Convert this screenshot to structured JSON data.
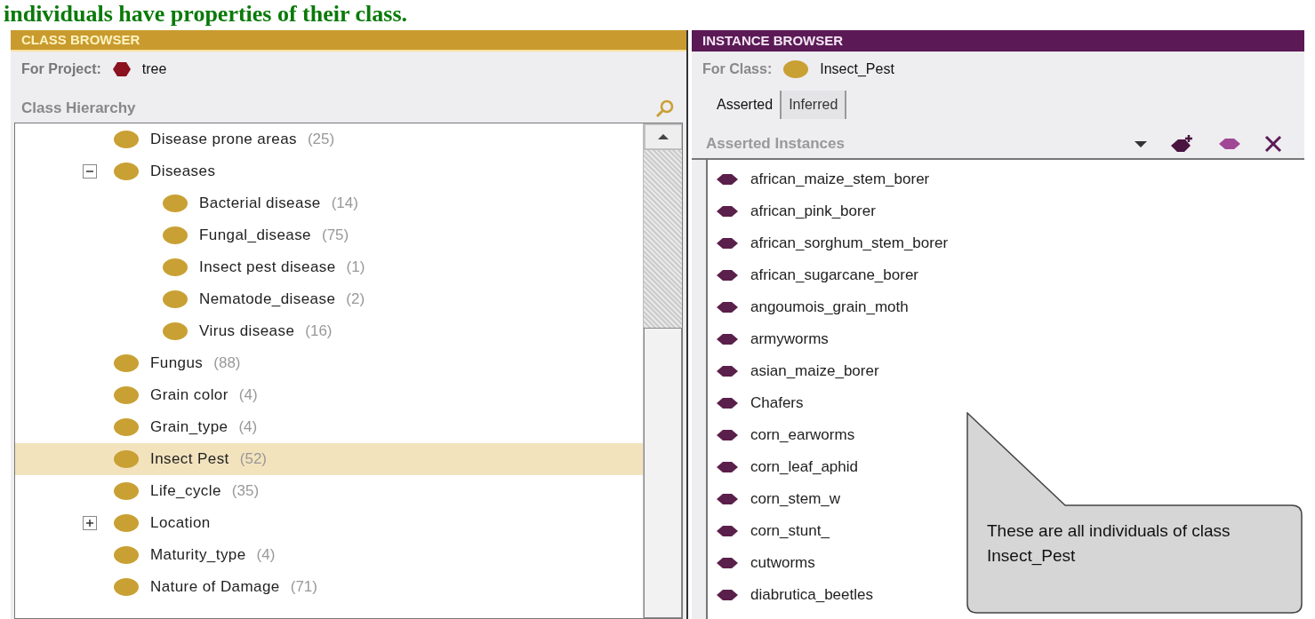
{
  "heading": "individuals have properties of their class.",
  "class_browser": {
    "title": "CLASS BROWSER",
    "project_label": "For Project:",
    "project_name": "tree",
    "hierarchy_label": "Class Hierarchy",
    "tree": [
      {
        "label": "Disease prone areas",
        "count": "(25)",
        "has_children": false,
        "expanded": false,
        "selected": false
      },
      {
        "label": "Diseases",
        "has_children": true,
        "expanded": true,
        "selected": false,
        "children": [
          {
            "label": "Bacterial disease",
            "count": "(14)",
            "has_children": false,
            "expanded": false,
            "selected": false
          },
          {
            "label": "Fungal_disease",
            "count": "(75)",
            "has_children": false,
            "expanded": false,
            "selected": false
          },
          {
            "label": "Insect pest disease",
            "count": "(1)",
            "has_children": false,
            "expanded": false,
            "selected": false
          },
          {
            "label": "Nematode_disease",
            "count": "(2)",
            "has_children": false,
            "expanded": false,
            "selected": false
          },
          {
            "label": "Virus disease",
            "count": "(16)",
            "has_children": false,
            "expanded": false,
            "selected": false
          }
        ]
      },
      {
        "label": "Fungus",
        "count": "(88)",
        "has_children": false,
        "expanded": false,
        "selected": false
      },
      {
        "label": "Grain color",
        "count": "(4)",
        "has_children": false,
        "expanded": false,
        "selected": false
      },
      {
        "label": "Grain_type",
        "count": "(4)",
        "has_children": false,
        "expanded": false,
        "selected": false
      },
      {
        "label": "Insect Pest",
        "count": "(52)",
        "has_children": false,
        "expanded": false,
        "selected": true
      },
      {
        "label": "Life_cycle",
        "count": "(35)",
        "has_children": false,
        "expanded": false,
        "selected": false
      },
      {
        "label": "Location",
        "has_children": true,
        "expanded": false,
        "selected": false
      },
      {
        "label": "Maturity_type",
        "count": "(4)",
        "has_children": false,
        "expanded": false,
        "selected": false
      },
      {
        "label": "Nature of Damage",
        "count": "(71)",
        "has_children": false,
        "expanded": false,
        "selected": false
      }
    ]
  },
  "instance_browser": {
    "title": "INSTANCE BROWSER",
    "class_label": "For Class:",
    "class_name": "Insect_Pest",
    "tabs": [
      {
        "label": "Asserted",
        "selected": true
      },
      {
        "label": "Inferred",
        "selected": false
      }
    ],
    "list_label": "Asserted Instances",
    "instances": [
      "african_maize_stem_borer",
      "african_pink_borer",
      "african_sorghum_stem_borer",
      "african_sugarcane_borer",
      "angoumois_grain_moth",
      "armyworms",
      "asian_maize_borer",
      "Chafers",
      "corn_earworms",
      "corn_leaf_aphid",
      "corn_stem_w",
      "corn_stunt_",
      "cutworms",
      "diabrutica_beetles"
    ]
  },
  "callout": {
    "text": "These are all individuals of class Insect_Pest"
  }
}
